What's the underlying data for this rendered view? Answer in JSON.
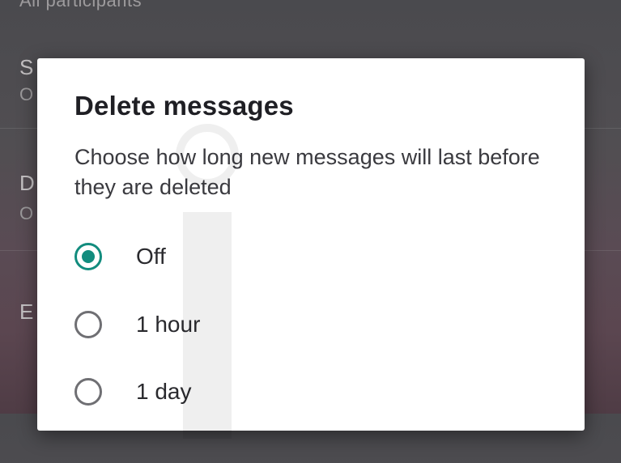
{
  "background_screen": {
    "top_text": "All participants",
    "rows": [
      {
        "title": "S",
        "subtitle": "O"
      },
      {
        "title": "D",
        "subtitle": "O"
      },
      {
        "title": "E"
      }
    ]
  },
  "dialog": {
    "title": "Delete messages",
    "description": "Choose how long new messages will last before they are deleted",
    "options": [
      {
        "label": "Off",
        "selected": true
      },
      {
        "label": "1 hour",
        "selected": false
      },
      {
        "label": "1 day",
        "selected": false
      }
    ]
  },
  "colors": {
    "accent": "#128c7e",
    "radio_unselected": "#6f6f73",
    "dialog_background": "#ffffff"
  },
  "icons": {
    "radio_selected": "radio-checked-icon",
    "radio_unselected": "radio-unchecked-icon"
  }
}
